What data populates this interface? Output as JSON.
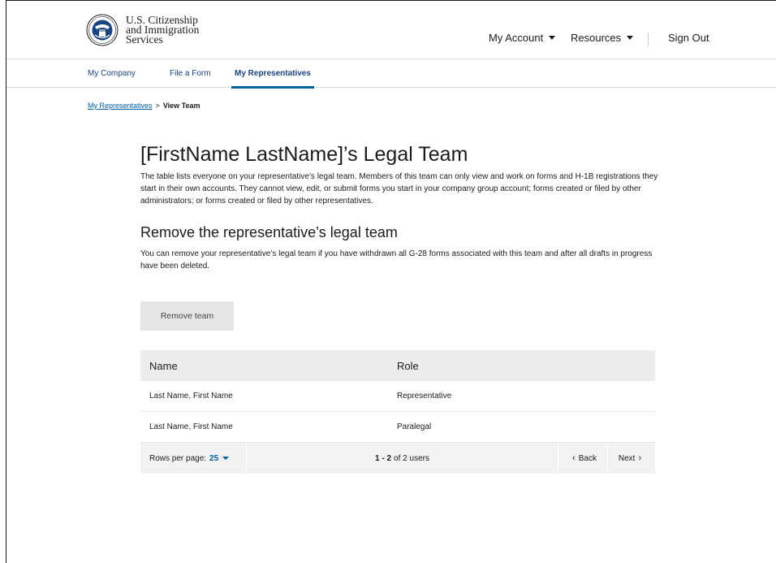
{
  "header": {
    "agency_line1": "U.S. Citizenship",
    "agency_line2": "and Immigration",
    "agency_line3": "Services",
    "nav": {
      "my_account": "My Account",
      "resources": "Resources",
      "sign_out": "Sign Out"
    }
  },
  "subnav": {
    "tabs": [
      {
        "label": "My Company"
      },
      {
        "label": "File a Form"
      },
      {
        "label": "My Representatives",
        "active": true
      }
    ]
  },
  "breadcrumb": {
    "parent": "My Representatives",
    "separator": ">",
    "current": "View Team"
  },
  "main": {
    "title": "[FirstName LastName]’s Legal Team",
    "description": "The table lists everyone on your representative’s legal team. Members of this team can only view and work on forms and H-1B registrations they start in their own accounts. They cannot view, edit, or submit forms you start in your company group account; forms created or filed by other administrators; or forms created or filed by other representatives.",
    "remove_heading": "Remove the representative’s legal team",
    "remove_description": "You can remove your representative’s legal team if you have withdrawn all G-28 forms associated with this team and after all drafts in progress have been deleted.",
    "remove_button": "Remove team"
  },
  "table": {
    "columns": [
      "Name",
      "Role"
    ],
    "rows": [
      {
        "name": "Last Name, First Name",
        "role": "Representative"
      },
      {
        "name": "Last Name, First Name",
        "role": "Paralegal"
      }
    ],
    "pagination": {
      "rows_per_page_label": "Rows per page:",
      "rows_per_page_value": "25",
      "range": "1 - 2",
      "of_text": "of 2 users",
      "back": "Back",
      "next": "Next"
    }
  },
  "colors": {
    "link": "#005ea2",
    "active_tab_underline": "#005ea2",
    "table_header_bg": "#ededed",
    "button_bg": "#e6e6e6"
  }
}
